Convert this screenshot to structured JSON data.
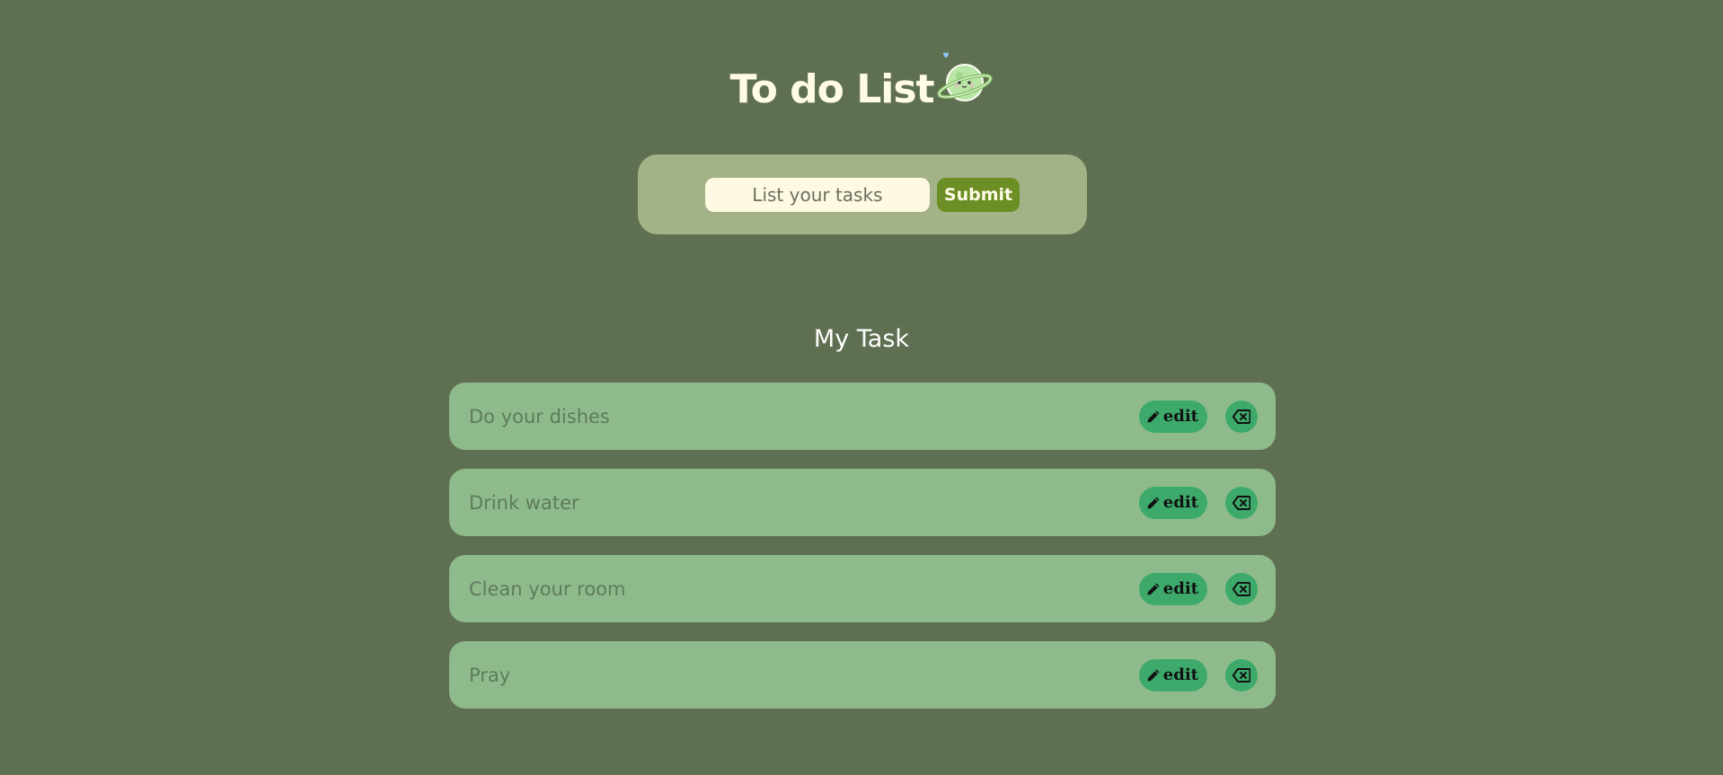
{
  "app": {
    "title": "To do List"
  },
  "form": {
    "input_placeholder": "List your tasks",
    "input_value": "",
    "submit_label": "Submit"
  },
  "tasks_section": {
    "title": "My Task",
    "edit_label": "edit",
    "items": [
      {
        "text": "Do your dishes"
      },
      {
        "text": "Drink water"
      },
      {
        "text": "Clean your room"
      },
      {
        "text": "Pray"
      }
    ]
  },
  "icons": {
    "mascot": "planet-mascot-icon",
    "edit": "pencil-icon",
    "delete": "backspace-x-icon"
  },
  "colors": {
    "background": "#5f7052",
    "form_card": "#a4b287",
    "input_bg": "#fdf9e3",
    "submit_bg": "#6b8f24",
    "task_row": "#8fbb8c",
    "action_btn": "#3daa6b"
  }
}
